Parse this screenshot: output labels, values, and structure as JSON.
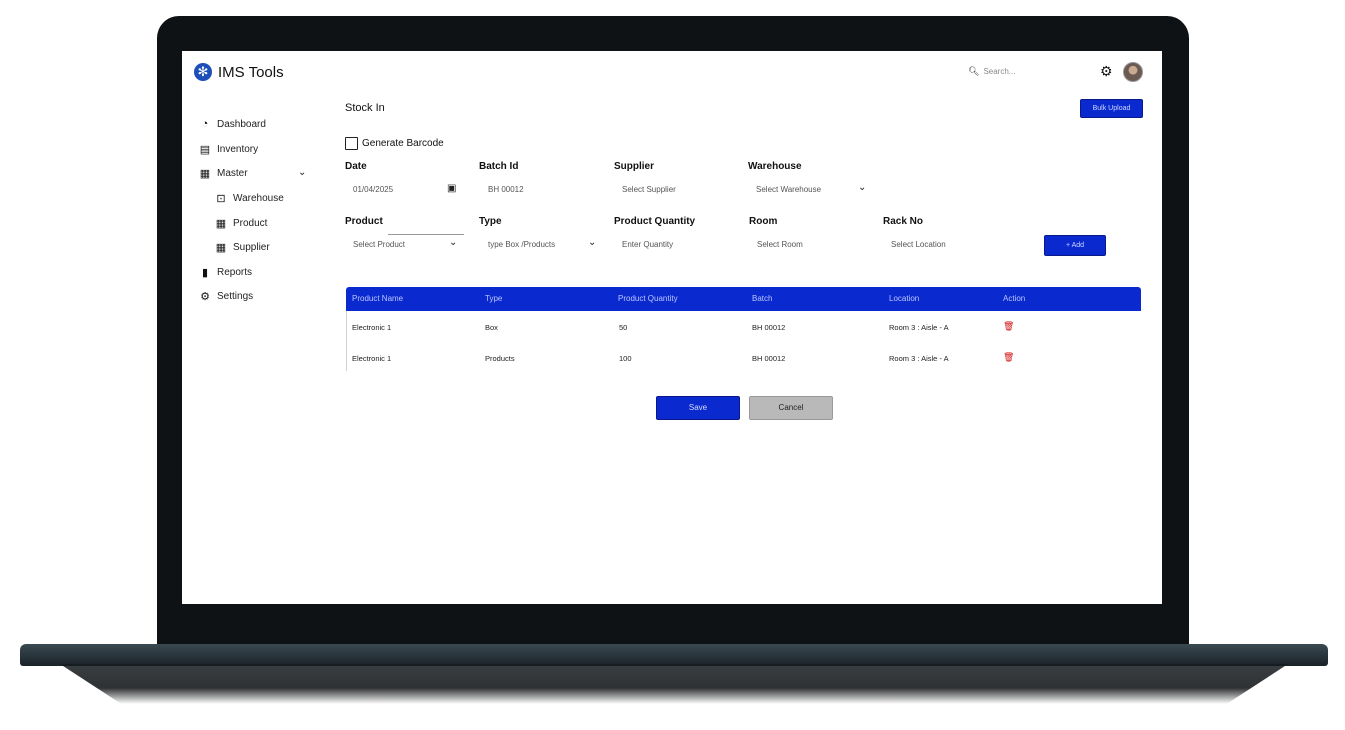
{
  "app": {
    "title": "IMS Tools"
  },
  "header": {
    "search_placeholder": "Search..."
  },
  "sidebar": {
    "items": [
      {
        "label": "Dashboard",
        "icon": "dashboard-icon"
      },
      {
        "label": "Inventory",
        "icon": "archive-icon"
      },
      {
        "label": "Master",
        "icon": "list-icon"
      },
      {
        "label": "Warehouse",
        "icon": "warehouse-icon"
      },
      {
        "label": "Product",
        "icon": "list-icon"
      },
      {
        "label": "Supplier",
        "icon": "list-icon"
      },
      {
        "label": "Reports",
        "icon": "bar-chart-icon"
      },
      {
        "label": "Settings",
        "icon": "gear-icon"
      }
    ]
  },
  "page": {
    "title": "Stock In",
    "bulk_upload": "Bulk Upload",
    "generate_barcode": "Generate Barcode"
  },
  "form": {
    "date": {
      "label": "Date",
      "value": "01/04/2025"
    },
    "batch": {
      "label": "Batch Id",
      "value": "BH 00012"
    },
    "supplier": {
      "label": "Supplier",
      "value": "Select Supplier"
    },
    "warehouse": {
      "label": "Warehouse",
      "value": "Select Warehouse"
    },
    "product": {
      "label": "Product",
      "value": "Select Product"
    },
    "type": {
      "label": "Type",
      "value": "type Box /Products"
    },
    "quantity": {
      "label": "Product Quantity",
      "value": "Enter Quantity"
    },
    "room": {
      "label": "Room",
      "value": "Select Room"
    },
    "rack": {
      "label": "Rack No",
      "value": "Select Location"
    },
    "add": "+ Add"
  },
  "table": {
    "headers": [
      "Product Name",
      "Type",
      "Product Quantity",
      "Batch",
      "Location",
      "Action"
    ],
    "rows": [
      [
        "Electronic 1",
        "Box",
        "50",
        "BH 00012",
        "Room 3 : Aisle - A"
      ],
      [
        "Electronic 1",
        "Products",
        "100",
        "BH 00012",
        "Room 3 : Aisle - A"
      ]
    ]
  },
  "actions": {
    "save": "Save",
    "cancel": "Cancel"
  },
  "colors": {
    "primary": "#0a2ad0",
    "cancel": "#b9b9b9",
    "delete": "#d01010"
  }
}
